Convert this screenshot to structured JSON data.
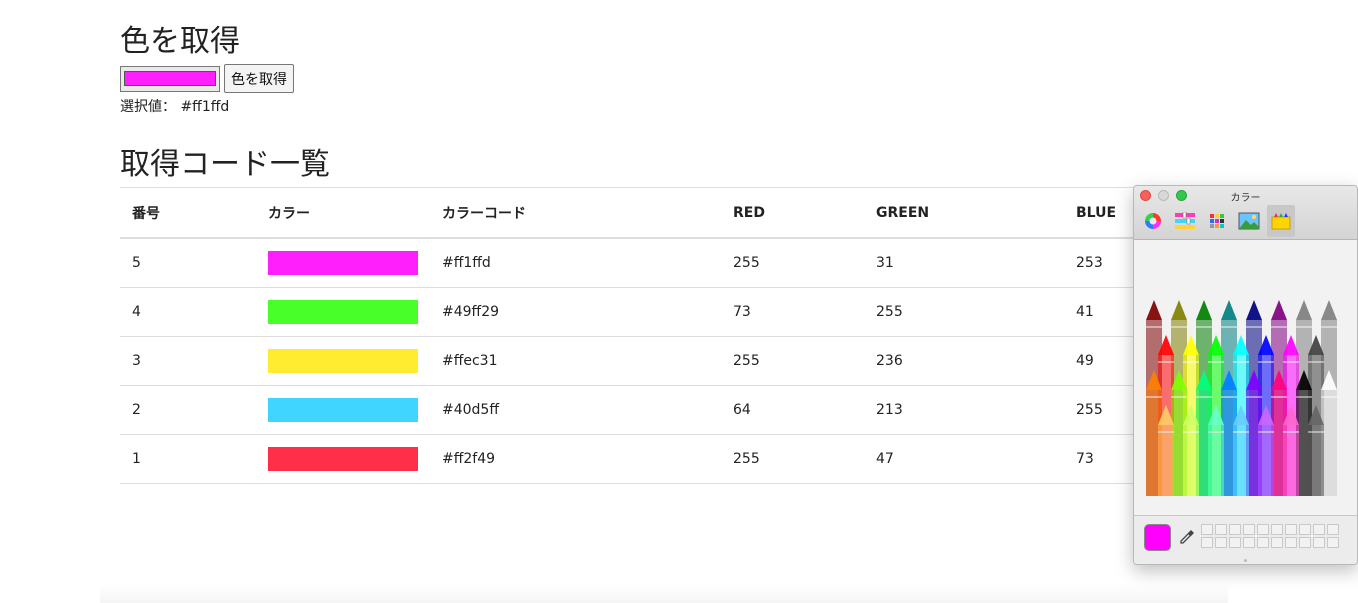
{
  "page": {
    "title": "色を取得",
    "button_label": "色を取得",
    "color_value": "#ff1ffd",
    "selected_label": "選択値：",
    "selected_value": "#ff1ffd",
    "list_title": "取得コード一覧"
  },
  "table": {
    "headers": [
      "番号",
      "カラー",
      "カラーコード",
      "RED",
      "GREEN",
      "BLUE"
    ],
    "rows": [
      {
        "no": "5",
        "hex": "#ff1ffd",
        "red": "255",
        "green": "31",
        "blue": "253"
      },
      {
        "no": "4",
        "hex": "#49ff29",
        "red": "73",
        "green": "255",
        "blue": "41"
      },
      {
        "no": "3",
        "hex": "#ffec31",
        "red": "255",
        "green": "236",
        "blue": "49"
      },
      {
        "no": "2",
        "hex": "#40d5ff",
        "red": "64",
        "green": "213",
        "blue": "255"
      },
      {
        "no": "1",
        "hex": "#ff2f49",
        "red": "255",
        "green": "47",
        "blue": "73"
      }
    ]
  },
  "color_panel": {
    "title": "カラー",
    "current_color": "#ff00ff",
    "tabs": [
      "color-wheel-icon",
      "sliders-icon",
      "palettes-icon",
      "image-palettes-icon",
      "pencils-icon"
    ],
    "active_tab": "pencils-icon",
    "crayon_colors": [
      [
        "#800000",
        "#808000",
        "#008000",
        "#008080",
        "#000080",
        "#800080",
        "#7f7f7f",
        "#808080"
      ],
      [
        "#ff0000",
        "#ffff00",
        "#00ff00",
        "#00ffff",
        "#0000ff",
        "#ff00ff",
        "#404040",
        "#a0a0a0"
      ],
      [
        "#ff8000",
        "#80ff00",
        "#00ff80",
        "#0080ff",
        "#8000ff",
        "#ff0080",
        "#000000",
        "#ffffff"
      ],
      [
        "#ffcc66",
        "#ccff66",
        "#66ffcc",
        "#66ccff",
        "#cc66ff",
        "#ff66cc",
        "#666666",
        "#e6e6e6"
      ]
    ],
    "favorite_slots": 20
  }
}
